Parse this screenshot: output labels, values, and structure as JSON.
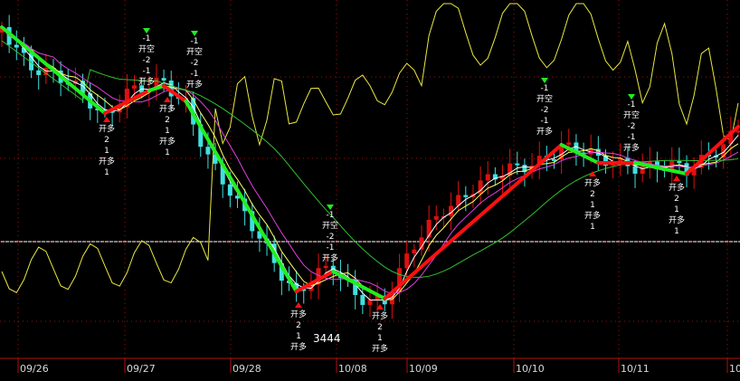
{
  "chart_data": {
    "type": "line",
    "title": "",
    "xlabel": "",
    "ylabel": "",
    "colors": {
      "background": "#000000",
      "up_candle": "#e01010",
      "down_candle": "#40e0e0",
      "buy_segment": "#ff1010",
      "sell_segment": "#20ee20",
      "ma_short": "#ffffff",
      "ma_mid": "#ffff60",
      "ma_long": "#e040e0",
      "ma_longer": "#30c030",
      "oscillator": "#e8e840",
      "axis": "#b01010",
      "grid": "#a01010"
    },
    "date_labels": [
      "09/26",
      "09/27",
      "09/28",
      "10/08",
      "10/09",
      "10/10",
      "10/11",
      "10"
    ],
    "price_label": "3444",
    "signal_labels": [
      {
        "id": "s1",
        "lines": [
          "开多",
          "2",
          "1",
          "开多",
          "1"
        ]
      },
      {
        "id": "s2",
        "lines": [
          "-1",
          "开空",
          "-2",
          "-1",
          "开多"
        ]
      },
      {
        "id": "s3",
        "lines": [
          "开多",
          "2",
          "1",
          "开多",
          "1"
        ]
      },
      {
        "id": "s4",
        "lines": [
          "-1",
          "开空",
          "-2",
          "-1",
          "开多"
        ]
      },
      {
        "id": "s5",
        "lines": [
          "-1",
          "开空",
          "-2",
          "-1",
          "开多"
        ]
      },
      {
        "id": "s6",
        "lines": [
          "开多",
          "2",
          "1",
          "开多"
        ]
      },
      {
        "id": "s7",
        "lines": [
          "开多",
          "2",
          "1",
          "开多"
        ]
      },
      {
        "id": "s8",
        "lines": [
          "-1",
          "开空",
          "-2",
          "-1",
          "开多"
        ]
      },
      {
        "id": "s9",
        "lines": [
          "开多",
          "2",
          "1",
          "开多",
          "1"
        ]
      },
      {
        "id": "s10",
        "lines": [
          "-1",
          "开空",
          "-2",
          "-1",
          "开多"
        ]
      },
      {
        "id": "s11",
        "lines": [
          "开多",
          "2",
          "1",
          "开多",
          "1"
        ]
      }
    ],
    "trend_segments": [
      {
        "direction": "sell",
        "from": 0,
        "to": 14
      },
      {
        "direction": "buy",
        "from": 14,
        "to": 20
      },
      {
        "direction": "sell",
        "from": 20,
        "to": 22
      },
      {
        "direction": "buy",
        "from": 22,
        "to": 25
      },
      {
        "direction": "sell",
        "from": 25,
        "to": 40
      },
      {
        "direction": "buy",
        "from": 40,
        "to": 45
      },
      {
        "direction": "sell",
        "from": 45,
        "to": 52
      },
      {
        "direction": "buy",
        "from": 52,
        "to": 76
      },
      {
        "direction": "sell",
        "from": 76,
        "to": 81
      },
      {
        "direction": "buy",
        "from": 81,
        "to": 86
      },
      {
        "direction": "sell",
        "from": 86,
        "to": 93
      },
      {
        "direction": "buy",
        "from": 93,
        "to": 100
      }
    ]
  }
}
